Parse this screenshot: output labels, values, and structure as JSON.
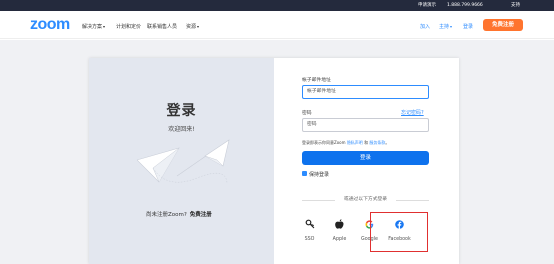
{
  "topbar": {
    "request_demo": "申请演示",
    "phone": "1.888.799.9666",
    "support": "支持"
  },
  "nav": {
    "logo": "zoom",
    "solutions": "解决方案",
    "plans_pricing": "计划和定价",
    "contact_sales": "联系销售人员",
    "resources": "资源",
    "join": "加入",
    "host": "主持",
    "login": "登录",
    "signup": "免费注册"
  },
  "left_panel": {
    "title": "登录",
    "welcome": "欢迎回来!",
    "no_account": "尚未注册Zoom?",
    "free_signup": "免费注册"
  },
  "form": {
    "email_label": "帐子邮件地址",
    "email_placeholder": "帐子邮件地址",
    "password_label": "密码",
    "forgot_password": "忘记密码?",
    "password_placeholder": "密码",
    "terms_text": "登录即表示你同意Zoom 隐私声明 和 服务条款。",
    "terms_privacy": "隐私声明",
    "terms_service": "服务条款",
    "login_button": "登录",
    "keep_signed_in": "保持登录",
    "alt_login": "或通过以下方式登录"
  },
  "sso_options": [
    {
      "label": "SSO",
      "icon": "key-icon"
    },
    {
      "label": "Apple",
      "icon": "apple-icon"
    },
    {
      "label": "Google",
      "icon": "google-icon"
    },
    {
      "label": "Facebook",
      "icon": "facebook-icon"
    }
  ],
  "colors": {
    "brand_blue": "#2d8cff",
    "primary_button": "#0e72ed",
    "signup_orange": "#ff742e",
    "topbar_dark": "#242a3d",
    "highlight_red": "#e03030"
  }
}
